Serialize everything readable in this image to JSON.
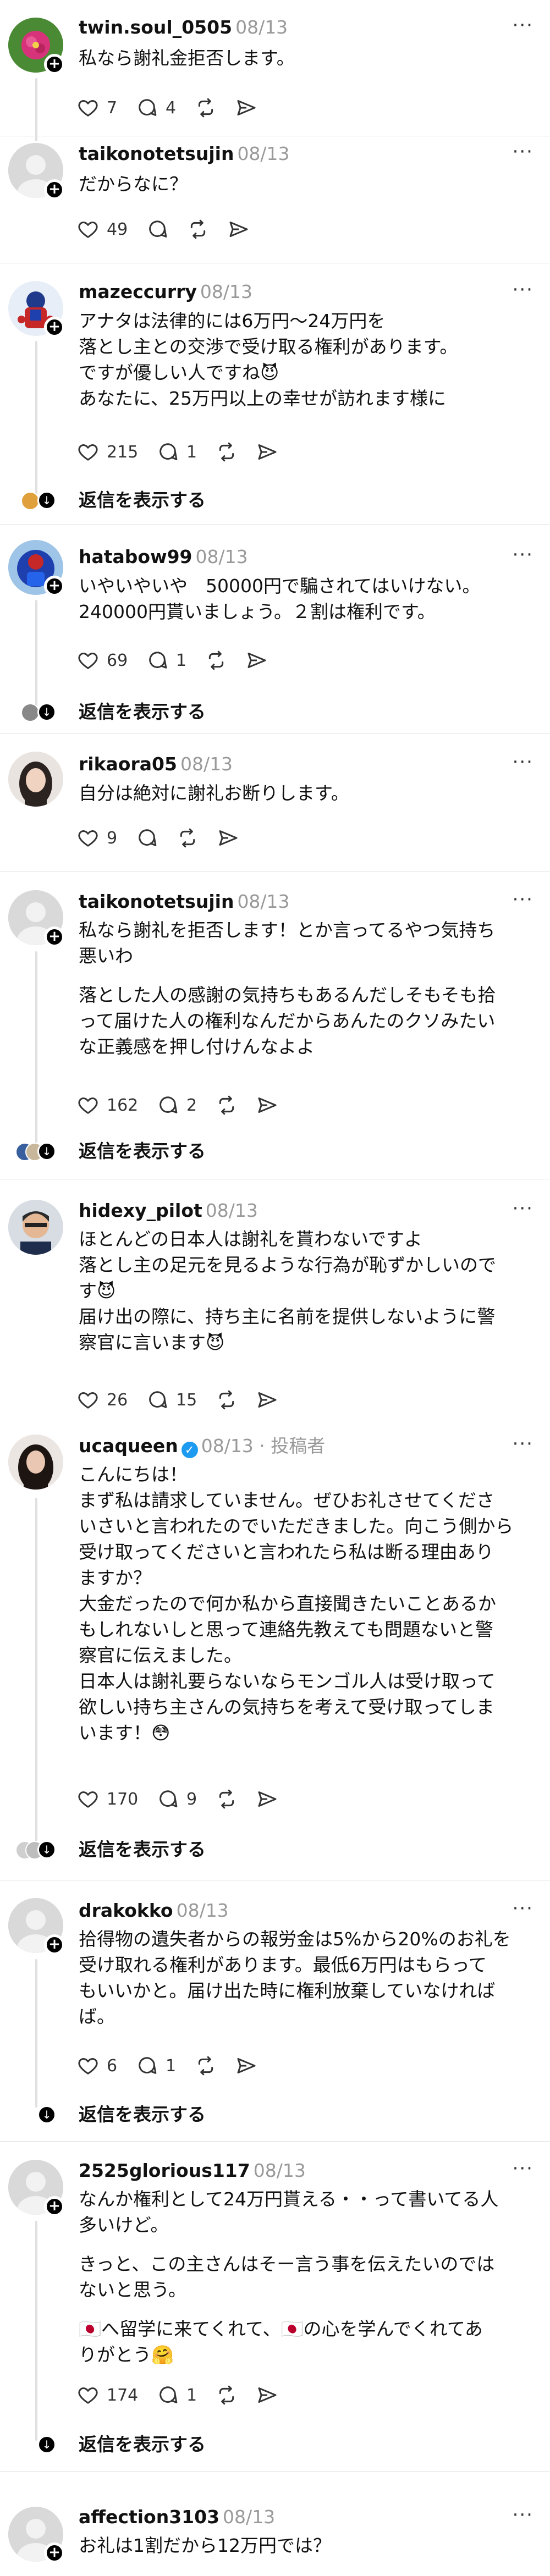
{
  "more_glyph": "···",
  "plus_glyph": "+",
  "verified_glyph": "✓",
  "posts": [
    {
      "username": "twin.soul_0505",
      "date": "08/13",
      "author_tag": "",
      "body": [
        "私なら謝礼金拒否します。"
      ],
      "likes": "7",
      "comments": "4",
      "reposts": "",
      "replies_link": ""
    },
    {
      "username": "taikonotetsujin",
      "date": "08/13",
      "author_tag": "",
      "body": [
        "だからなに？"
      ],
      "likes": "49",
      "comments": "",
      "reposts": "",
      "replies_link": ""
    },
    {
      "username": "mazeccurry",
      "date": "08/13",
      "author_tag": "",
      "body": [
        "アナタは法律的には6万円〜24万円を\n落とし主との交渉で受け取る権利があります。\nですが優しい人ですね😈\nあなたに、25万円以上の幸せが訪れます様に"
      ],
      "likes": "215",
      "comments": "1",
      "reposts": "",
      "replies_link": "返信を表示する"
    },
    {
      "username": "hatabow99",
      "date": "08/13",
      "author_tag": "",
      "body": [
        "いやいやいや　50000円で騙されてはいけない。\n240000円貰いましょう。２割は権利です。"
      ],
      "likes": "69",
      "comments": "1",
      "reposts": "",
      "replies_link": "返信を表示する"
    },
    {
      "username": "rikaora05",
      "date": "08/13",
      "author_tag": "",
      "body": [
        "自分は絶対に謝礼お断りします。"
      ],
      "likes": "9",
      "comments": "",
      "reposts": "",
      "replies_link": ""
    },
    {
      "username": "taikonotetsujin",
      "date": "08/13",
      "author_tag": "",
      "body": [
        "私なら謝礼を拒否します！とか言ってるやつ気持ち\n悪いわ",
        "落とした人の感謝の気持ちもあるんだしそもそも拾\nって届けた人の権利なんだからあんたのクソみたい\nな正義感を押し付けんなよよ"
      ],
      "likes": "162",
      "comments": "2",
      "reposts": "",
      "replies_link": "返信を表示する"
    },
    {
      "username": "hidexy_pilot",
      "date": "08/13",
      "author_tag": "",
      "body": [
        "ほとんどの日本人は謝礼を貰わないですよ\n落とし主の足元を見るような行為が恥ずかしいので\nす😈\n届け出の際に、持ち主に名前を提供しないように警\n察官に言います😈"
      ],
      "likes": "26",
      "comments": "15",
      "reposts": "",
      "replies_link": ""
    },
    {
      "username": "ucaqueen",
      "date": "08/13",
      "author_tag": "投稿者",
      "body": [
        "こんにちは！\nまず私は請求していません。ぜひお礼させてくださ\nいさいと言われたのでいただきました。向こう側から\n受け取ってくださいと言われたら私は断る理由あり\nますか？\n大金だったので何か私から直接聞きたいことあるか\nもしれないしと思って連絡先教えても問題ないと警\n察官に伝えました。\n日本人は謝礼要らないならモンゴル人は受け取って\n欲しい持ち主さんの気持ちを考えて受け取ってしま\nいます！😳"
      ],
      "likes": "170",
      "comments": "9",
      "reposts": "",
      "replies_link": "返信を表示する"
    },
    {
      "username": "drakokko",
      "date": "08/13",
      "author_tag": "",
      "body": [
        "拾得物の遺失者からの報労金は5%から20%のお礼を\n受け取れる権利があります。最低6万円はもらって\nもいいかと。届け出た時に権利放棄していなければ\nば。"
      ],
      "likes": "6",
      "comments": "1",
      "reposts": "",
      "replies_link": "返信を表示する"
    },
    {
      "username": "2525glorious117",
      "date": "08/13",
      "author_tag": "",
      "body": [
        "なんか権利として24万円貰える・・って書いてる人\n多いけど。",
        "きっと、この主さんはそー言う事を伝えたいのでは\nないと思う。",
        "🇯🇵へ留学に来てくれて、🇯🇵の心を学んでくれてあ\nりがとう🤗"
      ],
      "likes": "174",
      "comments": "1",
      "reposts": "",
      "replies_link": "返信を表示する"
    },
    {
      "username": "affection3103",
      "date": "08/13",
      "author_tag": "",
      "body": [
        "お礼は1割だから12万円では？"
      ],
      "likes": "",
      "comments": "",
      "reposts": "",
      "replies_link": ""
    }
  ]
}
